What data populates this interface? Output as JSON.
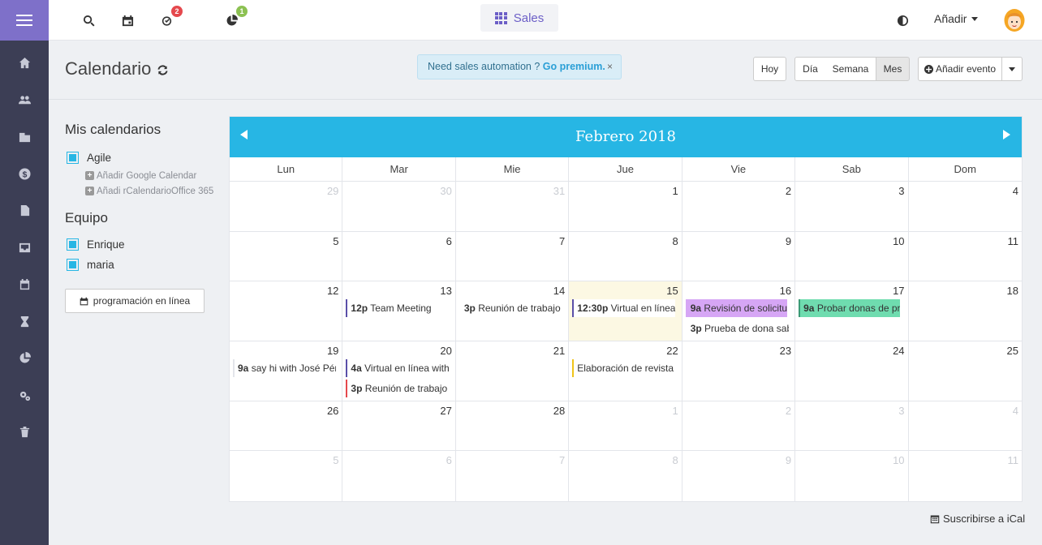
{
  "topbar": {
    "app_label": "Sales",
    "add_label": "Añadir",
    "badges": {
      "tasks": "2",
      "deals": "1"
    }
  },
  "header": {
    "title": "Calendario",
    "promo_text": "Need sales automation ?",
    "promo_link": "Go premium.",
    "promo_close": "×",
    "btn_today": "Hoy",
    "btn_day": "Día",
    "btn_week": "Semana",
    "btn_month": "Mes",
    "btn_add_event": "Añadir evento"
  },
  "side_panel": {
    "my_calendars_title": "Mis calendarios",
    "my_calendars": [
      "Agile"
    ],
    "add_google": "Añadir Google Calendar",
    "add_office": "Añadi rCalendarioOffice 365",
    "team_title": "Equipo",
    "team": [
      "Enrique",
      "maria"
    ],
    "online_button": "programación en línea"
  },
  "calendar": {
    "month_title": "Febrero 2018",
    "weekdays": [
      "Lun",
      "Mar",
      "Mie",
      "Jue",
      "Vie",
      "Sab",
      "Dom"
    ],
    "weeks": [
      [
        "29",
        "30",
        "31",
        "1",
        "2",
        "3",
        "4"
      ],
      [
        "5",
        "6",
        "7",
        "8",
        "9",
        "10",
        "11"
      ],
      [
        "12",
        "13",
        "14",
        "15",
        "16",
        "17",
        "18"
      ],
      [
        "19",
        "20",
        "21",
        "22",
        "23",
        "24",
        "25"
      ],
      [
        "26",
        "27",
        "28",
        "1",
        "2",
        "3",
        "4"
      ],
      [
        "5",
        "6",
        "7",
        "8",
        "9",
        "10",
        "11"
      ]
    ],
    "events": [
      {
        "time": "12p",
        "title": "Team Meeting"
      },
      {
        "time": "3p",
        "title": "Reunión de trabajo"
      },
      {
        "time": "12:30p",
        "title": "Virtual en línea v"
      },
      {
        "time": "9a",
        "title": "Revisión de solicitud"
      },
      {
        "time": "3p",
        "title": "Prueba de dona sabo"
      },
      {
        "time": "9a",
        "title": "Probar donas de prov"
      },
      {
        "time": "9a",
        "title": "say hi with José Pére"
      },
      {
        "time": "4a",
        "title": "Virtual en línea with !"
      },
      {
        "time": "3p",
        "title": "Reunión de trabajo"
      },
      {
        "time": "",
        "title": "Elaboración de revista"
      }
    ]
  },
  "footer": {
    "ical_label": "Suscribirse a iCal"
  },
  "colors": {
    "sidebar": "#3c3e55",
    "sidebar_top": "#7e70c9",
    "accent": "#27b6e4",
    "app_purple": "#6c5fc7",
    "today": "#fcf8e3",
    "event_purple": "#d6a6f5",
    "event_green": "#6fdcaf"
  }
}
